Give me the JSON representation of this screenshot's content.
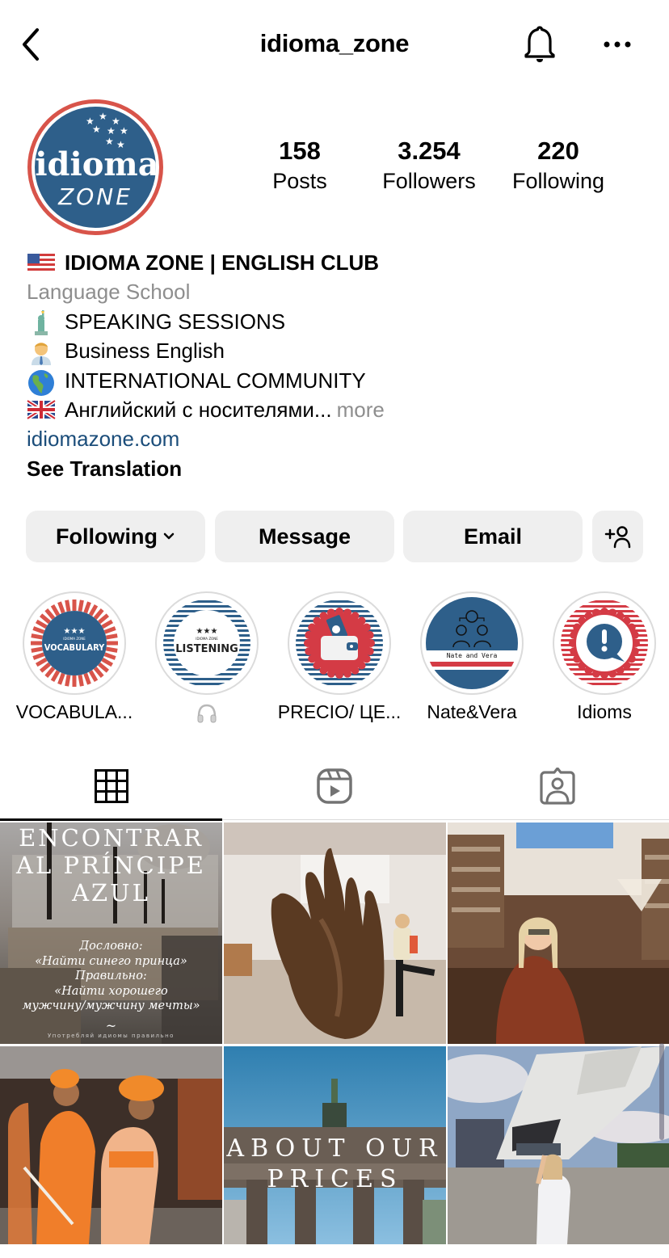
{
  "header": {
    "username": "idioma_zone",
    "back_icon": "chevron-left-icon",
    "notification_icon": "bell-icon",
    "more_icon": "more-horizontal-icon"
  },
  "profile": {
    "avatar_text_top": "idioma",
    "avatar_text_bottom": "ZONE",
    "stats": {
      "posts": {
        "value": "158",
        "label": "Posts"
      },
      "followers": {
        "value": "3.254",
        "label": "Followers"
      },
      "following": {
        "value": "220",
        "label": "Following"
      }
    }
  },
  "bio": {
    "name": "IDIOMA ZONE | ENGLISH CLUB",
    "name_emoji": "us-flag",
    "category": "Language School",
    "lines": [
      {
        "emoji": "statue-of-liberty",
        "text": "SPEAKING SESSIONS"
      },
      {
        "emoji": "man-office-worker",
        "text": "Business English"
      },
      {
        "emoji": "globe-americas",
        "text": "INTERNATIONAL COMMUNITY"
      },
      {
        "emoji": "uk-flag",
        "text": "Английский с носителями..."
      }
    ],
    "more_label": "more",
    "website": "idiomazone.com",
    "see_translation": "See Translation"
  },
  "actions": {
    "following_label": "Following",
    "message_label": "Message",
    "email_label": "Email",
    "add_person_icon": "add-person-icon"
  },
  "highlights": [
    {
      "label": "VOCABULA...",
      "cover_title": "VOCABULARY",
      "cover_sub": "IDIOMA ZONE",
      "cover_stars": "★★★"
    },
    {
      "label": "🎧",
      "label_icon": "headphones-icon",
      "cover_title": "LISTENING",
      "cover_sub": "IDIOMA ZONE",
      "cover_stars": "★★★"
    },
    {
      "label": "PRECIO/ ЦЕ...",
      "cover_title": "wallet"
    },
    {
      "label": "Nate&Vera",
      "cover_title": "Nate and Vera"
    },
    {
      "label": "Idioms",
      "cover_title": "!"
    }
  ],
  "tabs": [
    {
      "name": "posts-grid",
      "icon": "grid-icon",
      "active": true
    },
    {
      "name": "reels",
      "icon": "reels-icon",
      "active": false
    },
    {
      "name": "tagged",
      "icon": "tagged-person-icon",
      "active": false
    }
  ],
  "posts": [
    {
      "description": "Victoria Memorial idiom post",
      "title_lines": [
        "ENCONTRAR",
        "AL PRÍNCIPE",
        "AZUL"
      ],
      "body_lines": [
        "Дословно:",
        "«Найти синего принца»",
        "Правильно:",
        "«Найти хорошего",
        "мужчину/мужчину мечты»"
      ],
      "footer": "Употребляй идиомы правильно"
    },
    {
      "description": "Woman posing next to giant bronze hand sculpture"
    },
    {
      "description": "Woman in red jacket in ornate bookshop"
    },
    {
      "description": "Sadhus in orange robes at a market"
    },
    {
      "description": "Brandenburg Gate prices post",
      "title_lines": [
        "ABOUT OUR",
        "PRICES"
      ]
    },
    {
      "description": "Woman posing in front of futuristic museum"
    }
  ],
  "colors": {
    "brand_blue": "#2e5f8a",
    "brand_red": "#d8544a",
    "link_blue": "#1b4d7a",
    "secondary_text": "#8e8e8e",
    "button_bg": "#efefef"
  }
}
